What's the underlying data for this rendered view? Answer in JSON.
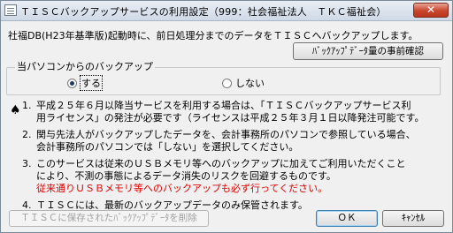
{
  "window": {
    "title": "ＴＩＳＣバックアップサービスの利用設定（999：社会福祉法人　ＴＫＣ福祉会）",
    "close_label": "✕"
  },
  "description": "社福DB(H23年基準版)起動時に、前日処理分までのデータをＴＩＳＣへバックアップします。",
  "confirm_button": "ﾊﾞｯｸｱｯﾌﾟﾃﾞｰﾀ量の事前確認",
  "group": {
    "legend": "当パソコンからのバックアップ",
    "options": [
      {
        "label": "する",
        "checked": true
      },
      {
        "label": "しない",
        "checked": false
      }
    ]
  },
  "notice_icon": "♠",
  "notes": [
    {
      "num": "1.",
      "lines": [
        "平成２５年６月以降当サービスを利用する場合は、「ＴＩＳＣバックアップサービス利",
        "用ライセンス」の発注が必要です（ライセンスは平成２５年３月１日以降発注可能です。"
      ]
    },
    {
      "num": "2.",
      "lines": [
        "関与先法人がバックアップしたデータを、会計事務所のパソコンで参照している場合、",
        "会計事務所のパソコンでは「しない」を選択してください。"
      ]
    },
    {
      "num": "3.",
      "lines": [
        "このサービスは従来のＵＳＢメモリ等へのバックアップに加えてご利用いただくこと",
        "により、不測の事態によるデータ消失のリスクを回避するものです。"
      ],
      "red_line": "従来通りＵＳＢメモリ等へのバックアップも必ず行ってください。"
    },
    {
      "num": "4.",
      "lines": [
        "ＴＩＳＣには、最新のバックアップデータのみ保管されます。"
      ]
    }
  ],
  "buttons": {
    "delete": "ＴＩＳＣに保存されたﾊﾞｯｸｱｯﾌﾟﾃﾞｰﾀを削除",
    "ok": "ＯＫ",
    "cancel": "ｷｬﾝｾﾙ"
  }
}
